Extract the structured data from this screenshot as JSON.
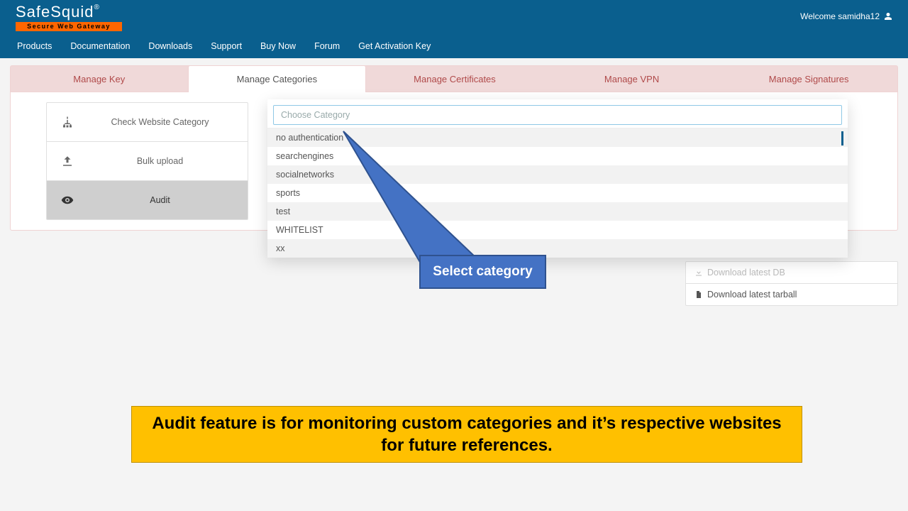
{
  "header": {
    "logo_main": "SafeSquid",
    "logo_reg": "®",
    "logo_sub": "Secure Web Gateway",
    "welcome_prefix": "Welcome ",
    "username": "samidha12"
  },
  "nav": {
    "products": "Products",
    "documentation": "Documentation",
    "downloads": "Downloads",
    "support": "Support",
    "buy_now": "Buy Now",
    "forum": "Forum",
    "get_activation_key": "Get Activation Key"
  },
  "tabs": {
    "manage_key": "Manage Key",
    "manage_categories": "Manage Categories",
    "manage_certificates": "Manage Certificates",
    "manage_vpn": "Manage VPN",
    "manage_signatures": "Manage Signatures"
  },
  "side": {
    "check": "Check Website Category",
    "bulk": "Bulk upload",
    "audit": "Audit"
  },
  "dropdown": {
    "placeholder": "Choose Category",
    "options": [
      "no authentication",
      "searchengines",
      "socialnetworks",
      "sports",
      "test",
      "WHITELIST",
      "xx"
    ]
  },
  "download": {
    "head": "Download latest DB",
    "row": "Download latest tarball"
  },
  "callout": {
    "text": "Select category"
  },
  "banner": {
    "text": "Audit feature is for monitoring custom categories and it’s respective websites for future references."
  }
}
